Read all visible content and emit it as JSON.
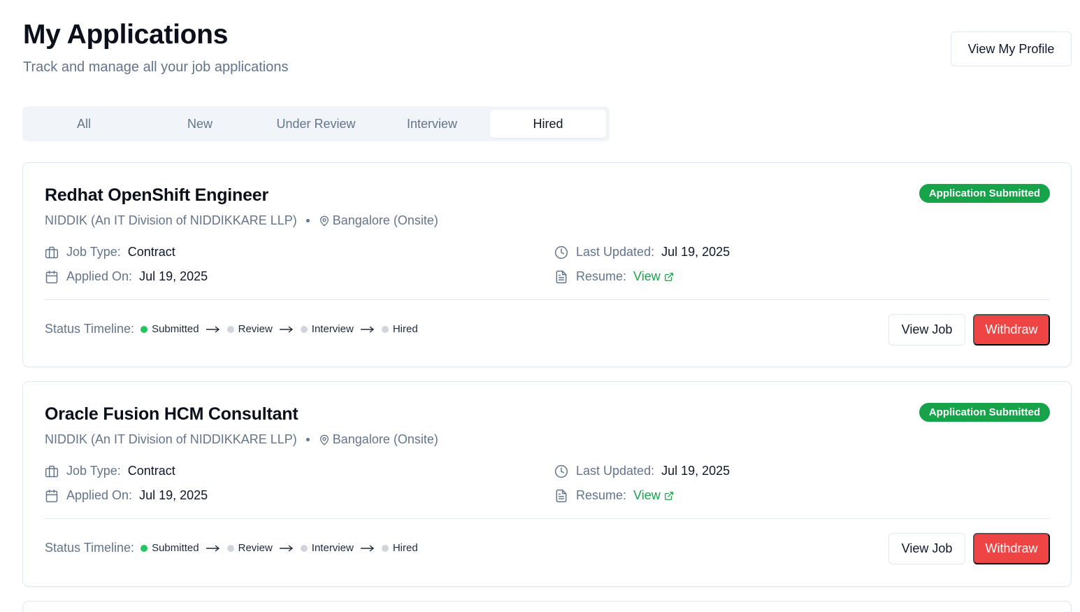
{
  "header": {
    "title": "My Applications",
    "subtitle": "Track and manage all your job applications",
    "profile_button": "View My Profile"
  },
  "tabs": [
    {
      "label": "All",
      "active": false
    },
    {
      "label": "New",
      "active": false
    },
    {
      "label": "Under Review",
      "active": false
    },
    {
      "label": "Interview",
      "active": false
    },
    {
      "label": "Hired",
      "active": true
    }
  ],
  "labels": {
    "job_type": "Job Type:",
    "applied_on": "Applied On:",
    "last_updated": "Last Updated:",
    "resume": "Resume:",
    "resume_link": "View",
    "status_timeline": "Status Timeline:",
    "view_job": "View Job",
    "withdraw": "Withdraw"
  },
  "applications": [
    {
      "title": "Redhat OpenShift Engineer",
      "company": "NIDDIK (An IT Division of NIDDIKKARE LLP)",
      "location": "Bangalore (Onsite)",
      "status": "Application Submitted",
      "job_type": "Contract",
      "applied_on": "Jul 19, 2025",
      "last_updated": "Jul 19, 2025",
      "timeline": [
        {
          "label": "Submitted",
          "done": true
        },
        {
          "label": "Review",
          "done": false
        },
        {
          "label": "Interview",
          "done": false
        },
        {
          "label": "Hired",
          "done": false
        }
      ]
    },
    {
      "title": "Oracle Fusion HCM Consultant",
      "company": "NIDDIK (An IT Division of NIDDIKKARE LLP)",
      "location": "Bangalore (Onsite)",
      "status": "Application Submitted",
      "job_type": "Contract",
      "applied_on": "Jul 19, 2025",
      "last_updated": "Jul 19, 2025",
      "timeline": [
        {
          "label": "Submitted",
          "done": true
        },
        {
          "label": "Review",
          "done": false
        },
        {
          "label": "Interview",
          "done": false
        },
        {
          "label": "Hired",
          "done": false
        }
      ]
    }
  ],
  "colors": {
    "accent_green": "#16a34a",
    "withdraw_red": "#ef4444",
    "muted_text": "#64748b"
  }
}
